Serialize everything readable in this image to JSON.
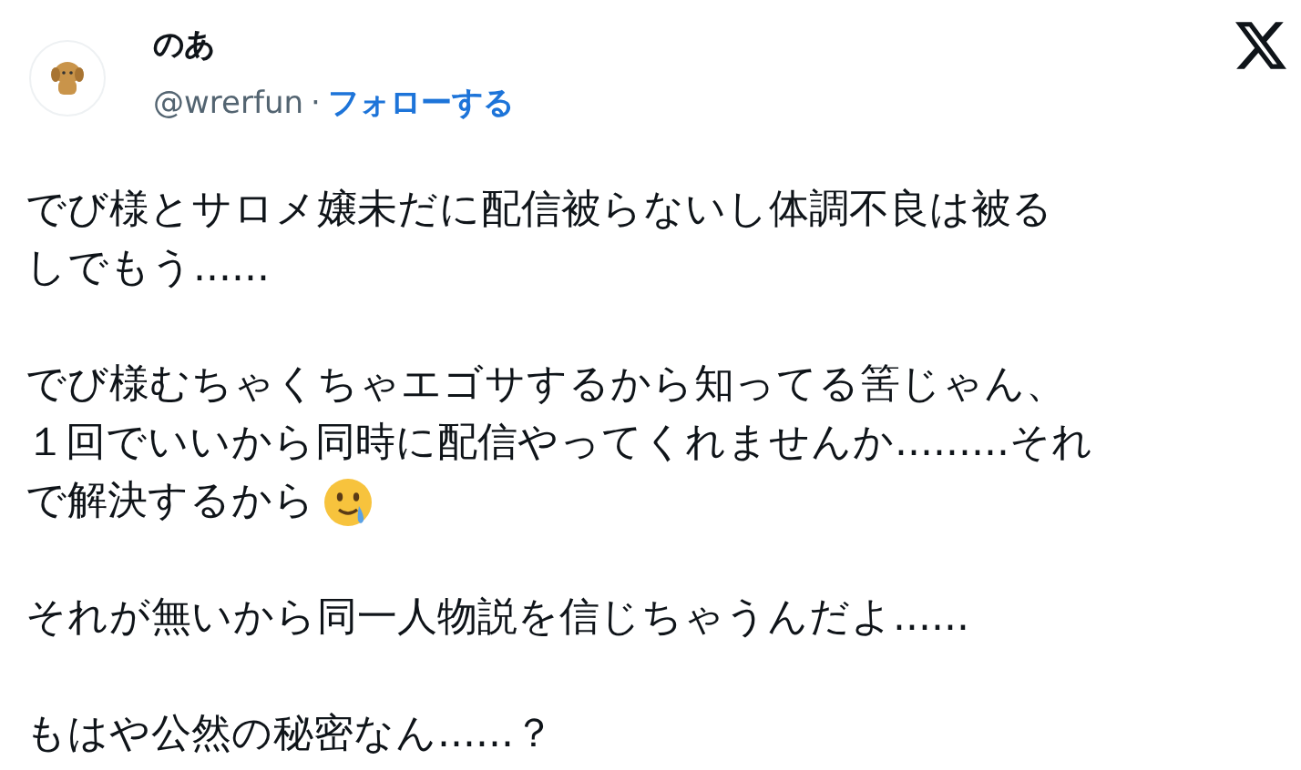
{
  "author": {
    "name": "のあ",
    "handle": "@wrerfun",
    "separator": "·",
    "follow": "フォローする"
  },
  "paragraphs": [
    {
      "lines": [
        "でび様とサロメ嬢未だに配信被らないし体調不良は被る",
        "しでもう......"
      ],
      "emoji_after": false
    },
    {
      "lines": [
        "でび様むちゃくちゃエゴサするから知ってる筈じゃん、",
        "１回でいいから同時に配信やってくれませんか.........それ",
        "で解決するから"
      ],
      "emoji_after": true
    },
    {
      "lines": [
        "それが無いから同一人物説を信じちゃうんだよ......"
      ],
      "emoji_after": false
    },
    {
      "lines": [
        "もはや公然の秘密なん......？"
      ],
      "emoji_after": false
    }
  ]
}
